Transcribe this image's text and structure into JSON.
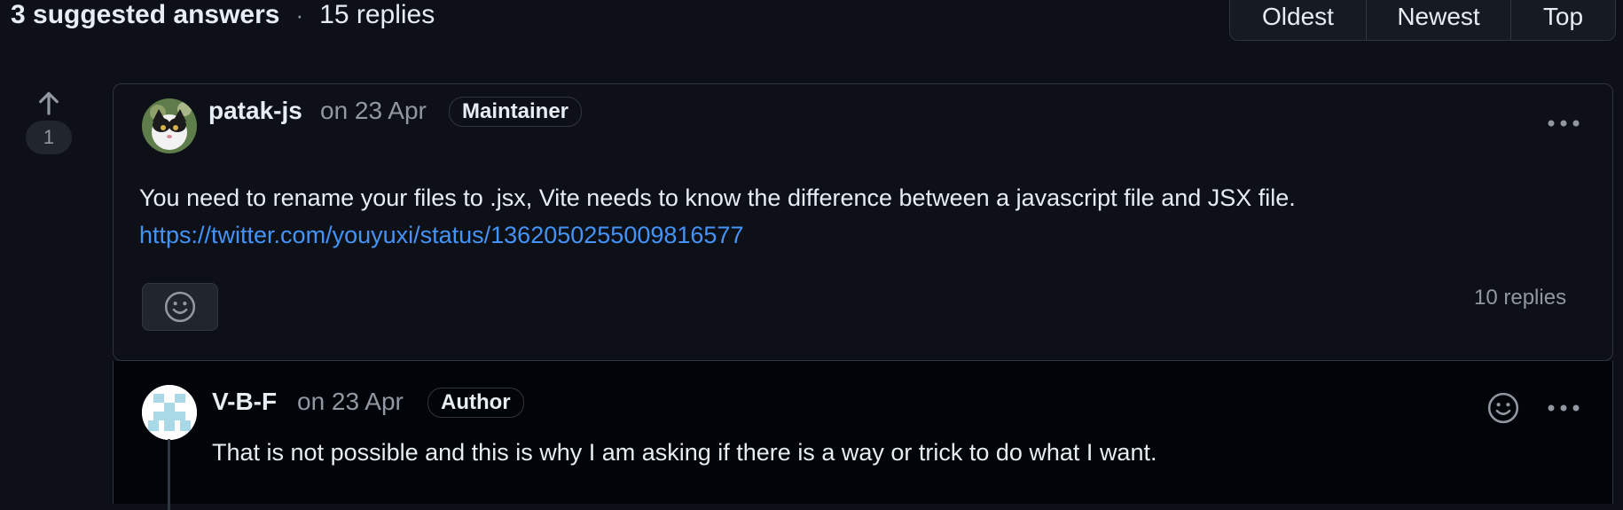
{
  "header": {
    "suggested": "3 suggested answers",
    "separator": "·",
    "replies": "15 replies"
  },
  "sort": {
    "options": [
      "Oldest",
      "Newest",
      "Top"
    ]
  },
  "vote": {
    "count": "1"
  },
  "answer": {
    "author": "patak-js",
    "date": "on 23 Apr",
    "badge": "Maintainer",
    "body": "You need to rename your files to .jsx, Vite needs to know the difference between a javascript file and JSX file.",
    "link": "https://twitter.com/youyuxi/status/1362050255009816577",
    "reply_count": "10 replies",
    "icons": [
      "avatar",
      "kebab-menu-icon",
      "smiley-icon"
    ]
  },
  "reply": {
    "author": "V-B-F",
    "date": "on 23 Apr",
    "badge": "Author",
    "body": "That is not possible and this is why I am asking if there is a way or trick to do what I want.",
    "icons": [
      "identicon-avatar",
      "smiley-icon",
      "kebab-menu-icon"
    ]
  },
  "colors": {
    "background": "#0d1117",
    "border": "#30363d",
    "link": "#4493f8",
    "muted": "#9198a1"
  }
}
